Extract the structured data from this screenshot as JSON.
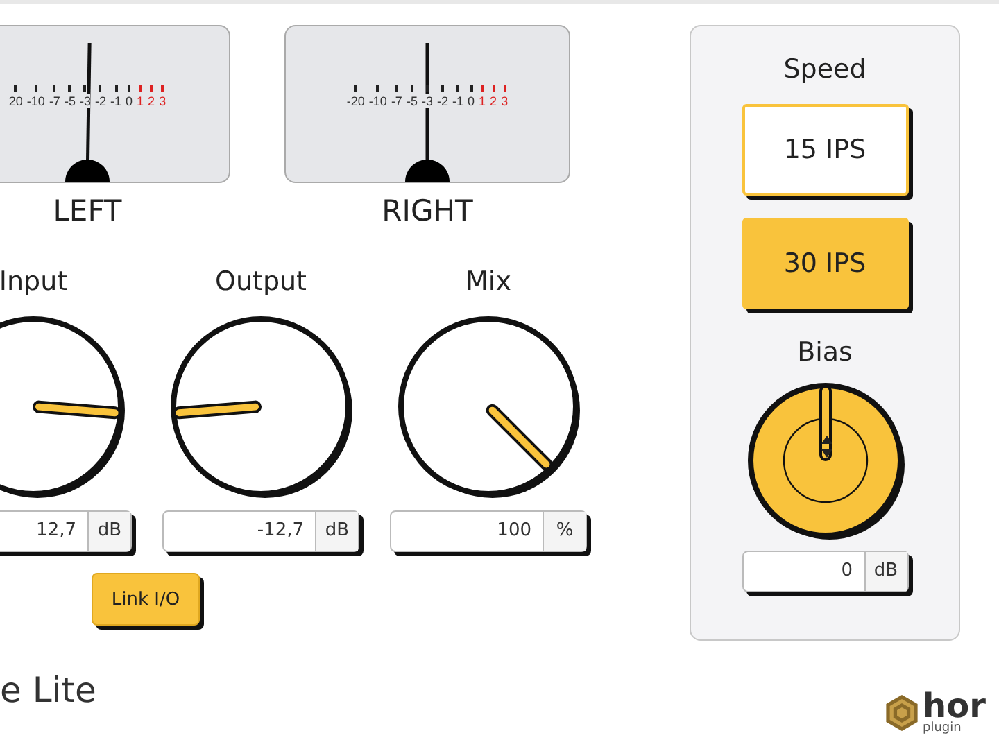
{
  "meters": [
    {
      "label": "LEFT",
      "scale": [
        {
          "text": "20",
          "over": false
        },
        {
          "text": "-10",
          "over": false
        },
        {
          "text": "-7",
          "over": false
        },
        {
          "text": "-5",
          "over": false
        },
        {
          "text": "-3",
          "over": false
        },
        {
          "text": "-2",
          "over": false
        },
        {
          "text": "-1",
          "over": false
        },
        {
          "text": "0",
          "over": false
        },
        {
          "text": "1",
          "over": true
        },
        {
          "text": "2",
          "over": true
        },
        {
          "text": "3",
          "over": true
        }
      ]
    },
    {
      "label": "RIGHT",
      "scale": [
        {
          "text": "-20",
          "over": false
        },
        {
          "text": "-10",
          "over": false
        },
        {
          "text": "-7",
          "over": false
        },
        {
          "text": "-5",
          "over": false
        },
        {
          "text": "-3",
          "over": false
        },
        {
          "text": "-2",
          "over": false
        },
        {
          "text": "-1",
          "over": false
        },
        {
          "text": "0",
          "over": false
        },
        {
          "text": "1",
          "over": true
        },
        {
          "text": "2",
          "over": true
        },
        {
          "text": "3",
          "over": true
        }
      ]
    }
  ],
  "knobs": [
    {
      "label": "Input",
      "value": "12,7",
      "unit": "dB"
    },
    {
      "label": "Output",
      "value": "-12,7",
      "unit": "dB"
    },
    {
      "label": "Mix",
      "value": "100",
      "unit": "%"
    }
  ],
  "link_button": {
    "label": "Link I/O",
    "on": true
  },
  "title": "e Lite",
  "speed": {
    "label": "Speed",
    "options": [
      {
        "label": "15 IPS",
        "selected": false
      },
      {
        "label": "30 IPS",
        "selected": true
      }
    ]
  },
  "bias": {
    "label": "Bias",
    "value": "0",
    "unit": "dB"
  },
  "logo": {
    "text": "hor",
    "subtext": "plugin"
  }
}
